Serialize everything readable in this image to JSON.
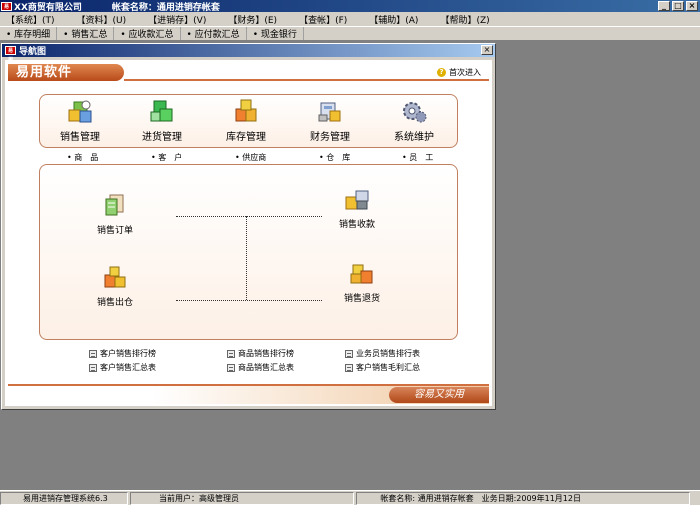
{
  "titlebar": {
    "logo": "易用",
    "company": "XX商贸有限公司",
    "account_set": "帐套名称：通用进销存帐套",
    "minimize": "_",
    "restore": "□",
    "close": "×"
  },
  "menu": [
    {
      "label": "【系统】(T)"
    },
    {
      "label": "【资料】(U)"
    },
    {
      "label": "【进销存】(V)"
    },
    {
      "label": "【财务】(E)"
    },
    {
      "label": "【查帐】(F)"
    },
    {
      "label": "【辅助】(A)"
    },
    {
      "label": "【帮助】(Z)"
    }
  ],
  "quickbar": [
    {
      "label": "• 库存明细"
    },
    {
      "label": "• 销售汇总"
    },
    {
      "label": "• 应收款汇总"
    },
    {
      "label": "• 应付款汇总"
    },
    {
      "label": "• 现金银行"
    }
  ],
  "nav_window": {
    "title": "导航图",
    "close": "×",
    "logo": "易用",
    "banner": "易用软件",
    "first_login": "首次进入",
    "help_glyph": "?",
    "modules": [
      {
        "label": "销售管理",
        "icon": "sales-icon"
      },
      {
        "label": "进货管理",
        "icon": "purchase-icon"
      },
      {
        "label": "库存管理",
        "icon": "inventory-icon"
      },
      {
        "label": "财务管理",
        "icon": "finance-icon"
      },
      {
        "label": "系统维护",
        "icon": "system-icon"
      }
    ],
    "sub_items": [
      {
        "label": "• 商　品"
      },
      {
        "label": "• 客　户"
      },
      {
        "label": "• 供应商"
      },
      {
        "label": "• 仓　库"
      },
      {
        "label": "• 员　工"
      }
    ],
    "flow": {
      "sales_order": "销售订单",
      "sales_receipt": "销售收款",
      "sales_out": "销售出仓",
      "sales_return": "销售退货"
    },
    "reports": [
      {
        "label": "客户销售排行榜"
      },
      {
        "label": "商品销售排行榜"
      },
      {
        "label": "业务员销售排行表"
      },
      {
        "label": "客户销售汇总表"
      },
      {
        "label": "商品销售汇总表"
      },
      {
        "label": "客户销售毛利汇总"
      }
    ],
    "slogan": "容易又实用"
  },
  "statusbar": {
    "system": "易用进销存管理系统6.3",
    "user": "当前用户：高级管理员",
    "account_set": "帐套名称: 通用进销存帐套",
    "business_date": "业务日期:2009年11月12日"
  },
  "colors": {
    "accent": "#b84a1a",
    "titlebar": "#0a246a",
    "desktop": "#808080"
  }
}
